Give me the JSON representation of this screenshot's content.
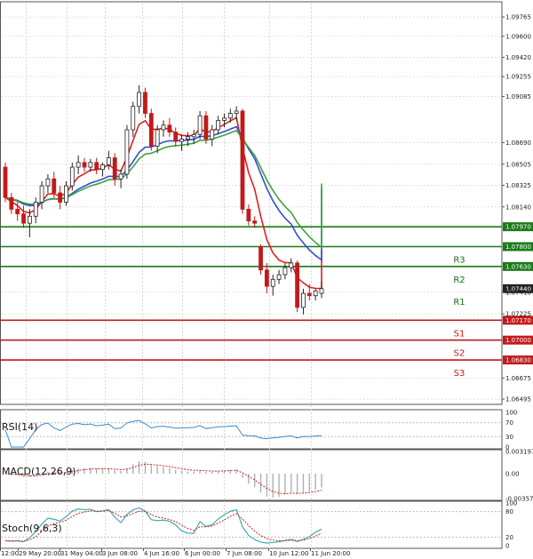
{
  "chart_data": [
    {
      "type": "candlestick",
      "panel": "price",
      "y_ticks": [
        "1.09765",
        "1.09600",
        "1.09420",
        "1.09255",
        "1.09085",
        "1.08690",
        "1.08505",
        "1.08325",
        "1.08140",
        "1.07410",
        "1.07225",
        "1.06675",
        "1.06495"
      ],
      "ylim": [
        1.0645,
        1.0988
      ],
      "time_labels": [
        "12:00",
        "29 May 20:00",
        "31 May 04:00",
        "3 Jun 08:00",
        "4 Jun 16:00",
        "6 Jun 00:00",
        "7 Jun 08:00",
        "10 Jun 12:00",
        "11 Jun 20:00"
      ],
      "levels": [
        {
          "name": "",
          "value": 1.0797,
          "tag": "1.07970",
          "color": "#1a7a1a"
        },
        {
          "name": "R3",
          "value": 1.078,
          "tag": "1.07800",
          "color": "#1a7a1a"
        },
        {
          "name": "R2",
          "value": 1.0763,
          "tag": "1.07630",
          "color": "#1a7a1a"
        },
        {
          "name": "R1",
          "value": 1.0744,
          "tag": "1.07440",
          "color": "#222222",
          "current": true
        },
        {
          "name": "S1",
          "value": 1.0717,
          "tag": "1.07170",
          "color": "#c21a1a"
        },
        {
          "name": "S2",
          "value": 1.07,
          "tag": "1.07000",
          "color": "#c21a1a"
        },
        {
          "name": "S3",
          "value": 1.0683,
          "tag": "1.06830",
          "color": "#c21a1a"
        }
      ],
      "candles": [
        [
          1.0848,
          1.0852,
          1.0818,
          1.0822
        ],
        [
          1.0822,
          1.0826,
          1.0808,
          1.0812
        ],
        [
          1.0812,
          1.0818,
          1.0802,
          1.0808
        ],
        [
          1.0808,
          1.0815,
          1.0796,
          1.08
        ],
        [
          1.08,
          1.0812,
          1.0788,
          1.0806
        ],
        [
          1.0806,
          1.0822,
          1.08,
          1.0818
        ],
        [
          1.0818,
          1.0836,
          1.0812,
          1.0832
        ],
        [
          1.0832,
          1.0842,
          1.0826,
          1.0838
        ],
        [
          1.0838,
          1.0844,
          1.0822,
          1.0826
        ],
        [
          1.0826,
          1.0832,
          1.0812,
          1.0818
        ],
        [
          1.0818,
          1.0836,
          1.0815,
          1.0832
        ],
        [
          1.0832,
          1.0852,
          1.0828,
          1.0848
        ],
        [
          1.0848,
          1.0858,
          1.0842,
          1.0852
        ],
        [
          1.0852,
          1.0856,
          1.0844,
          1.0848
        ],
        [
          1.0848,
          1.0855,
          1.0844,
          1.0852
        ],
        [
          1.0852,
          1.0856,
          1.0842,
          1.0846
        ],
        [
          1.0846,
          1.0852,
          1.084,
          1.085
        ],
        [
          1.085,
          1.0862,
          1.0846,
          1.0856
        ],
        [
          1.0856,
          1.086,
          1.0832,
          1.0838
        ],
        [
          1.0838,
          1.0846,
          1.083,
          1.0842
        ],
        [
          1.0842,
          1.0884,
          1.0838,
          1.088
        ],
        [
          1.088,
          1.0904,
          1.0874,
          1.09
        ],
        [
          1.09,
          1.0918,
          1.0894,
          1.0912
        ],
        [
          1.0912,
          1.0916,
          1.089,
          1.0894
        ],
        [
          1.0894,
          1.0898,
          1.0862,
          1.0866
        ],
        [
          1.0866,
          1.0884,
          1.086,
          1.088
        ],
        [
          1.088,
          1.0888,
          1.0874,
          1.0884
        ],
        [
          1.0884,
          1.089,
          1.0874,
          1.0878
        ],
        [
          1.0878,
          1.0882,
          1.0866,
          1.087
        ],
        [
          1.087,
          1.0876,
          1.0862,
          1.0872
        ],
        [
          1.0872,
          1.0878,
          1.0866,
          1.0874
        ],
        [
          1.0874,
          1.088,
          1.0868,
          1.0876
        ],
        [
          1.0876,
          1.0896,
          1.0872,
          1.0892
        ],
        [
          1.0892,
          1.0896,
          1.0868,
          1.0872
        ],
        [
          1.0872,
          1.0884,
          1.0866,
          1.088
        ],
        [
          1.088,
          1.0892,
          1.0876,
          1.0888
        ],
        [
          1.0888,
          1.0894,
          1.0882,
          1.089
        ],
        [
          1.089,
          1.0898,
          1.0886,
          1.0894
        ],
        [
          1.0894,
          1.09,
          1.0888,
          1.0896
        ],
        [
          1.0896,
          1.0898,
          1.0808,
          1.0812
        ],
        [
          1.0812,
          1.0816,
          1.0798,
          1.0802
        ],
        [
          1.0802,
          1.0806,
          1.0796,
          1.08
        ],
        [
          1.078,
          1.0782,
          1.0756,
          1.076
        ],
        [
          1.076,
          1.0766,
          1.074,
          1.0746
        ],
        [
          1.0746,
          1.0756,
          1.0738,
          1.0752
        ],
        [
          1.0752,
          1.076,
          1.0748,
          1.0756
        ],
        [
          1.0756,
          1.0766,
          1.0752,
          1.0762
        ],
        [
          1.0762,
          1.077,
          1.0758,
          1.0766
        ],
        [
          1.0766,
          1.0768,
          1.0724,
          1.0728
        ],
        [
          1.0728,
          1.0744,
          1.0722,
          1.074
        ],
        [
          1.074,
          1.0748,
          1.0734,
          1.0738
        ],
        [
          1.0738,
          1.0744,
          1.0734,
          1.0742
        ],
        [
          1.074,
          1.075,
          1.0736,
          1.0744
        ]
      ]
    },
    {
      "type": "line",
      "panel": "rsi",
      "title": "RSI(14)",
      "y_ticks": [
        "100",
        "70",
        "30",
        "0"
      ],
      "ylim": [
        0,
        100
      ],
      "levels": [
        30,
        70
      ]
    },
    {
      "type": "bar",
      "panel": "macd",
      "title": "MACD(12,26,9)",
      "y_ticks": [
        "0.003197",
        "0.00",
        "-0.003573"
      ],
      "ylim": [
        -0.003573,
        0.003197
      ]
    },
    {
      "type": "line",
      "panel": "stoch",
      "title": "Stoch(9,6,3)",
      "y_ticks": [
        "100",
        "80",
        "20",
        "0"
      ],
      "ylim": [
        0,
        100
      ],
      "levels": [
        20,
        80
      ]
    }
  ],
  "colors": {
    "bull": "#1a8a1a",
    "bear": "#c21a1a",
    "ma_fast": "#e02020",
    "ma_mid": "#3050d0",
    "ma_slow": "#40a040",
    "rsi": "#3a8ad0",
    "macd": "#b0b0b0",
    "signal": "#d02020",
    "stoch_main": "#2aa6b0",
    "stoch_signal": "#d02020"
  }
}
